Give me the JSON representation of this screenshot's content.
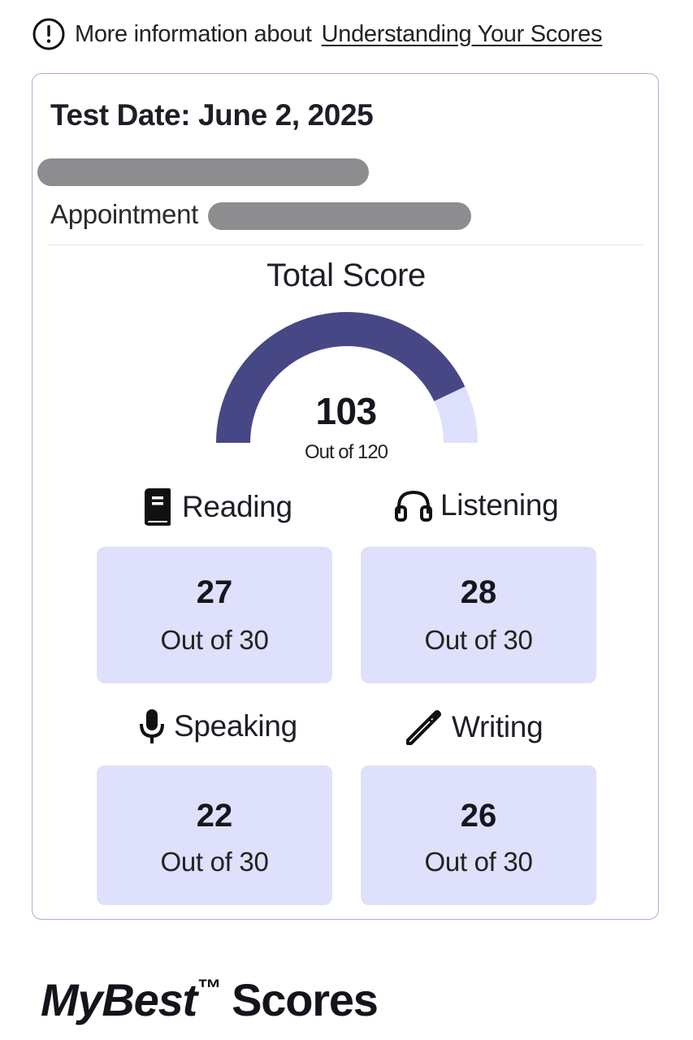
{
  "info": {
    "prefix": "More information about",
    "link": "Understanding Your Scores",
    "icon": "alert-circle-icon"
  },
  "card": {
    "test_date": "Test Date: June 2, 2025",
    "appointment_label": "Appointment"
  },
  "total": {
    "title": "Total Score",
    "score": "103",
    "out_of": "Out of 120",
    "value": 103,
    "max": 120,
    "colors": {
      "fill": "#474785",
      "track": "#dfe0fb"
    }
  },
  "sections": [
    {
      "name": "Reading",
      "icon": "book-icon",
      "score": "27",
      "out_of": "Out of 30"
    },
    {
      "name": "Listening",
      "icon": "headphones-icon",
      "score": "28",
      "out_of": "Out of 30"
    },
    {
      "name": "Speaking",
      "icon": "microphone-icon",
      "score": "22",
      "out_of": "Out of 30"
    },
    {
      "name": "Writing",
      "icon": "pencil-icon",
      "score": "26",
      "out_of": "Out of 30"
    }
  ],
  "footer": {
    "brand": "MyBest",
    "tm": "™",
    "suffix": "Scores"
  }
}
